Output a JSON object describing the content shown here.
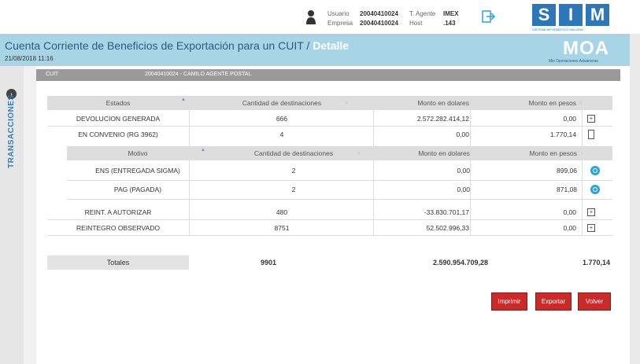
{
  "header": {
    "user_label": "Usuario",
    "user_value": "20040410024",
    "company_label": "Empresa",
    "company_value": "20040410024",
    "agent_label": "T. Agente",
    "agent_value": "IMEX",
    "host_label": "Host",
    "host_value": ".143",
    "sim_letters": [
      "S",
      "I",
      "M"
    ],
    "sim_subtitle": "SISTEMA INFORMÁTICO MALVINA"
  },
  "banner": {
    "title": "Cuenta Corriente de Beneficios de Exportación para un CUIT /",
    "detail": "Detalle",
    "date": "21/08/2018 11:16",
    "moa": "MOA",
    "moa_subtitle": "Mis Operaciones Aduaneras"
  },
  "sidebar": {
    "label": "TRANSACCIONES",
    "expand": "›"
  },
  "cuit_bar": {
    "label": "CUIT",
    "value": "20040410024 - CAMILO AGENTE POSTAL"
  },
  "table": {
    "headers": [
      "Estados",
      "Cantidad de destinaciones",
      "Monto en dolares",
      "Monto en pesos"
    ],
    "rows_top": [
      {
        "estado": "DEVOLUCION GENERADA",
        "cantidad": "666",
        "dolares": "2.572.282.414,12",
        "pesos": "0,00"
      },
      {
        "estado": "EN CONVENIO (RG 3962)",
        "cantidad": "4",
        "dolares": "0,00",
        "pesos": "1.770,14"
      }
    ],
    "sub_headers": [
      "Motivo",
      "Cantidad de destinaciones",
      "Monto en dolares",
      "Monto en pesos"
    ],
    "sub_rows": [
      {
        "motivo": "ENS (ENTREGADA SIGMA)",
        "cantidad": "2",
        "dolares": "0,00",
        "pesos": "899,06"
      },
      {
        "motivo": "PAG (PAGADA)",
        "cantidad": "2",
        "dolares": "0,00",
        "pesos": "871,08"
      }
    ],
    "rows_bottom": [
      {
        "estado": "REINT. A AUTORIZAR",
        "cantidad": "480",
        "dolares": "-33.830.701,17",
        "pesos": "0,00"
      },
      {
        "estado": "REINTEGRO OBSERVADO",
        "cantidad": "8751",
        "dolares": "52.502.996,33",
        "pesos": "0,00"
      }
    ]
  },
  "totals": {
    "label": "Totales",
    "cantidad": "9901",
    "dolares": "2.590.954.709,28",
    "pesos": "1.770,14"
  },
  "buttons": {
    "print": "Imprimir",
    "export": "Exportar",
    "back": "Volver"
  },
  "colors": {
    "banner": "#a8d5e6",
    "brand_blue": "#2d77b8",
    "button_red": "#c92a2a"
  }
}
